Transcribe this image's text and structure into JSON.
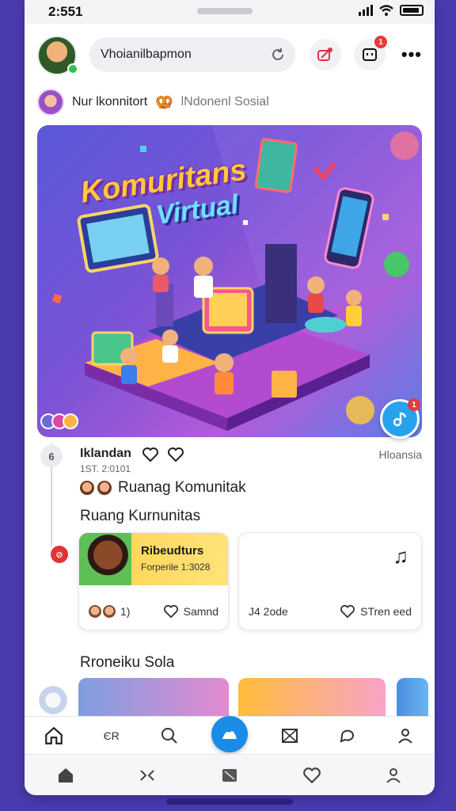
{
  "status_bar": {
    "time": "2:551"
  },
  "header": {
    "search_text": "Vhoianilbapmon",
    "notification_count": "1"
  },
  "community": {
    "name": "Nur lkonnitort",
    "emoji": "🥨",
    "subtitle": "lNdonenl Sosial"
  },
  "hero": {
    "title_line1": "Komuritans",
    "title_line2": "Virtual",
    "music_badge": "1"
  },
  "post": {
    "user": "Iklandan",
    "date": "1ST. 2:0101",
    "tag": "Hloansia",
    "thread_node_label": "6"
  },
  "room_label": "Ruanag Komunitak",
  "section_title": "Ruang Kurnunitas",
  "cards": [
    {
      "title": "Ribeudturs",
      "subtitle": "Forperile 1:3028",
      "count": "1)",
      "action": "Samnd"
    },
    {
      "count": "J4 2ode",
      "action": "STren eed"
    }
  ],
  "section2_title": "Rroneiku Sola",
  "nav_top": [
    {
      "icon": "home-icon"
    },
    {
      "label": "ЄR"
    },
    {
      "icon": "search-icon"
    },
    {
      "icon": "create-icon"
    },
    {
      "icon": "gallery-icon"
    },
    {
      "icon": "chat-icon"
    },
    {
      "icon": "profile-icon"
    }
  ],
  "nav_bottom": [
    {
      "icon": "home-icon"
    },
    {
      "icon": "shuffle-icon"
    },
    {
      "icon": "media-icon"
    },
    {
      "icon": "heart-icon"
    },
    {
      "icon": "profile-icon"
    }
  ],
  "colors": {
    "accent": "#1a8ce8",
    "background": "#4a3bb0",
    "badge": "#e63a3a"
  }
}
